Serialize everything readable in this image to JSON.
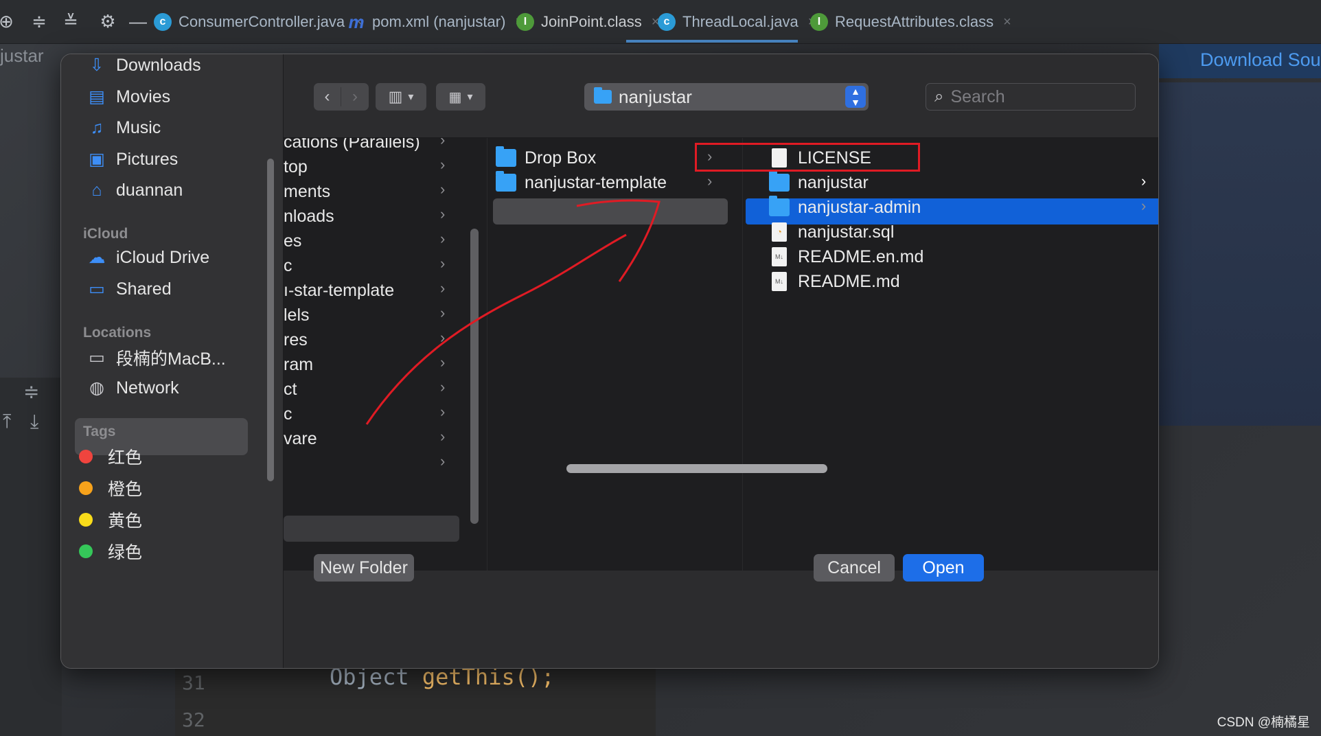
{
  "ide": {
    "tabs": [
      {
        "label": "ConsumerController.java",
        "icon": "c",
        "color": "#2b9bd6"
      },
      {
        "label": "pom.xml (nanjustar)",
        "icon": "m",
        "color": "#3d6fd6"
      },
      {
        "label": "JoinPoint.class",
        "icon": "I",
        "color": "#4e9a3a"
      },
      {
        "label": "ThreadLocal.java",
        "icon": "c",
        "color": "#2b9bd6"
      },
      {
        "label": "RequestAttributes.class",
        "icon": "I",
        "color": "#4e9a3a"
      }
    ],
    "project_label": "justar",
    "download_link": "Download Sou",
    "code_lines": [
      {
        "number": "31",
        "text": "Object ",
        "method": "getThis();"
      },
      {
        "number": "32",
        "text": ""
      }
    ],
    "watermark": "CSDN @楠橘星"
  },
  "dialog": {
    "sidebar": {
      "favorites": [
        {
          "label": "Downloads",
          "icon": "download-icon"
        },
        {
          "label": "Movies",
          "icon": "film-icon"
        },
        {
          "label": "Music",
          "icon": "music-note-icon"
        },
        {
          "label": "Pictures",
          "icon": "pictures-icon"
        },
        {
          "label": "duannan",
          "icon": "home-icon"
        }
      ],
      "icloud_header": "iCloud",
      "icloud": [
        {
          "label": "iCloud Drive",
          "icon": "cloud-icon"
        },
        {
          "label": "Shared",
          "icon": "shared-folder-icon"
        }
      ],
      "locations_header": "Locations",
      "locations": [
        {
          "label": "段楠的MacB...",
          "icon": "laptop-icon",
          "selected": true
        },
        {
          "label": "Network",
          "icon": "globe-icon"
        }
      ],
      "tags_header": "Tags",
      "tags": [
        {
          "label": "红色",
          "color": "#f0443e"
        },
        {
          "label": "橙色",
          "color": "#f7a21b"
        },
        {
          "label": "黄色",
          "color": "#f9dc1a"
        },
        {
          "label": "绿色",
          "color": "#35c759"
        }
      ]
    },
    "toolbar": {
      "back_icon": "chevron-left-icon",
      "forward_icon": "chevron-right-icon",
      "view_mode": "columns",
      "group_mode": "grid",
      "path": "nanjustar",
      "search_placeholder": "Search"
    },
    "column1": [
      "cations (Parallels)",
      "top",
      "ments",
      "nloads",
      "es",
      "c",
      "ı-star-template",
      "lels",
      "res",
      "ram",
      "ct",
      "c",
      "vare",
      ""
    ],
    "column2": [
      {
        "label": "Drop Box",
        "type": "folder",
        "has_children": true
      },
      {
        "label": "nanjustar-template",
        "type": "folder",
        "has_children": true,
        "selected": true
      }
    ],
    "column3": [
      {
        "label": "LICENSE",
        "type": "file",
        "has_children": false
      },
      {
        "label": "nanjustar",
        "type": "folder",
        "has_children": true,
        "selected": true
      },
      {
        "label": "nanjustar-admin",
        "type": "folder",
        "has_children": true
      },
      {
        "label": "nanjustar.sql",
        "type": "sql",
        "has_children": false
      },
      {
        "label": "README.en.md",
        "type": "markdown",
        "has_children": false
      },
      {
        "label": "README.md",
        "type": "markdown",
        "has_children": false
      }
    ],
    "buttons": {
      "new_folder": "New Folder",
      "cancel": "Cancel",
      "open": "Open"
    }
  }
}
